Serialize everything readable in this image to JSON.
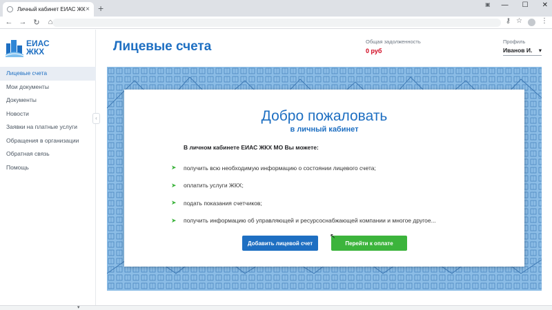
{
  "browser": {
    "tab_title": "Личный кабинет ЕИАС ЖКХ",
    "close_glyph": "×",
    "new_tab_glyph": "+",
    "back_glyph": "←",
    "forward_glyph": "→",
    "reload_glyph": "↻",
    "home_glyph": "⌂",
    "key_glyph": "⚷",
    "star_glyph": "☆",
    "menu_glyph": "⋮",
    "minimize_glyph": "—",
    "maximize_glyph": "☐",
    "window_close_glyph": "✕",
    "ext_glyph": "▣"
  },
  "sidebar": {
    "logo_line1": "ЕИАС",
    "logo_line2": "ЖКХ",
    "items": [
      {
        "label": "Лицевые счета"
      },
      {
        "label": "Мои документы"
      },
      {
        "label": "Документы"
      },
      {
        "label": "Новости"
      },
      {
        "label": "Заявки на платные услуги"
      },
      {
        "label": "Обращения в организации"
      },
      {
        "label": "Обратная связь"
      },
      {
        "label": "Помощь"
      }
    ],
    "collapse_glyph": "‹"
  },
  "header": {
    "title": "Лицевые счета",
    "debt_label": "Общая задолженность",
    "debt_value": "0 руб",
    "profile_label": "Профиль",
    "profile_name": "Иванов И.",
    "profile_chevron": "▾"
  },
  "card": {
    "title": "Добро пожаловать",
    "subtitle": "в личный кабинет",
    "intro": "В личном кабинете ЕИАС ЖКХ МО Вы можете:",
    "bullet": "➤",
    "features": [
      "получить всю необходимую информацию о состоянии лицевого счета;",
      "оплатить услуги ЖКХ;",
      "подать показания счетчиков;",
      "получить информацию об управляющей и ресурсоснабжающей компании и многое другое..."
    ],
    "add_account_button": "Добавить лицевой счет",
    "pay_button": "Перейти к оплате"
  },
  "colors": {
    "accent": "#1e6fc2",
    "debt": "#d0021b",
    "pay": "#3cb43c",
    "banner": "#8cbde6"
  }
}
